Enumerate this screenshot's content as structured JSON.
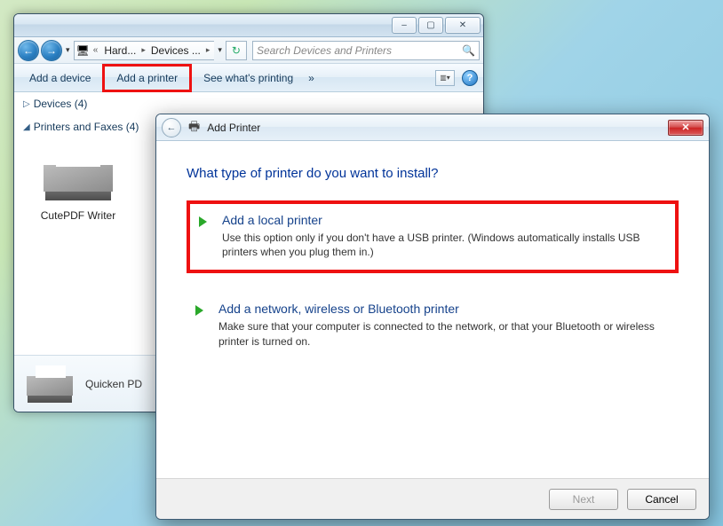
{
  "parent": {
    "breadcrumb": {
      "part1": "Hard...",
      "part2": "Devices ..."
    },
    "search_placeholder": "Search Devices and Printers",
    "toolbar": {
      "add_device": "Add a device",
      "add_printer": "Add a printer",
      "see_printing": "See what's printing",
      "overflow": "»"
    },
    "groups": {
      "devices": "Devices (4)",
      "printers": "Printers and Faxes (4)"
    },
    "items": {
      "cutepdf": "CutePDF Writer"
    },
    "details": {
      "selected": "Quicken PD"
    }
  },
  "wizard": {
    "title": "Add Printer",
    "heading": "What type of printer do you want to install?",
    "options": [
      {
        "label": "Add a local printer",
        "desc": "Use this option only if you don't have a USB printer. (Windows automatically installs USB printers when you plug them in.)"
      },
      {
        "label": "Add a network, wireless or Bluetooth printer",
        "desc": "Make sure that your computer is connected to the network, or that your Bluetooth or wireless printer is turned on."
      }
    ],
    "buttons": {
      "next": "Next",
      "cancel": "Cancel"
    }
  }
}
